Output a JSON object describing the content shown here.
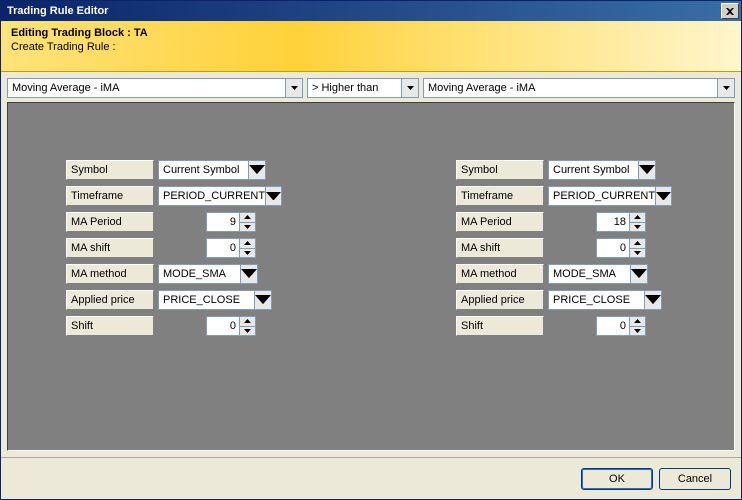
{
  "title": "Trading Rule Editor",
  "header": {
    "line1": "Editing Trading Block : TA",
    "line2": "Create Trading Rule :"
  },
  "top": {
    "left_indicator": "Moving Average - iMA",
    "comparison": "> Higher than",
    "right_indicator": "Moving Average - iMA"
  },
  "labels": {
    "symbol": "Symbol",
    "timeframe": "Timeframe",
    "ma_period": "MA Period",
    "ma_shift": "MA shift",
    "ma_method": "MA method",
    "applied_price": "Applied price",
    "shift": "Shift"
  },
  "left": {
    "symbol": "Current Symbol",
    "timeframe": "PERIOD_CURRENT",
    "ma_period": "9",
    "ma_shift": "0",
    "ma_method": "MODE_SMA",
    "applied_price": "PRICE_CLOSE",
    "shift": "0"
  },
  "right": {
    "symbol": "Current Symbol",
    "timeframe": "PERIOD_CURRENT",
    "ma_period": "18",
    "ma_shift": "0",
    "ma_method": "MODE_SMA",
    "applied_price": "PRICE_CLOSE",
    "shift": "0"
  },
  "footer": {
    "ok": "OK",
    "cancel": "Cancel"
  }
}
